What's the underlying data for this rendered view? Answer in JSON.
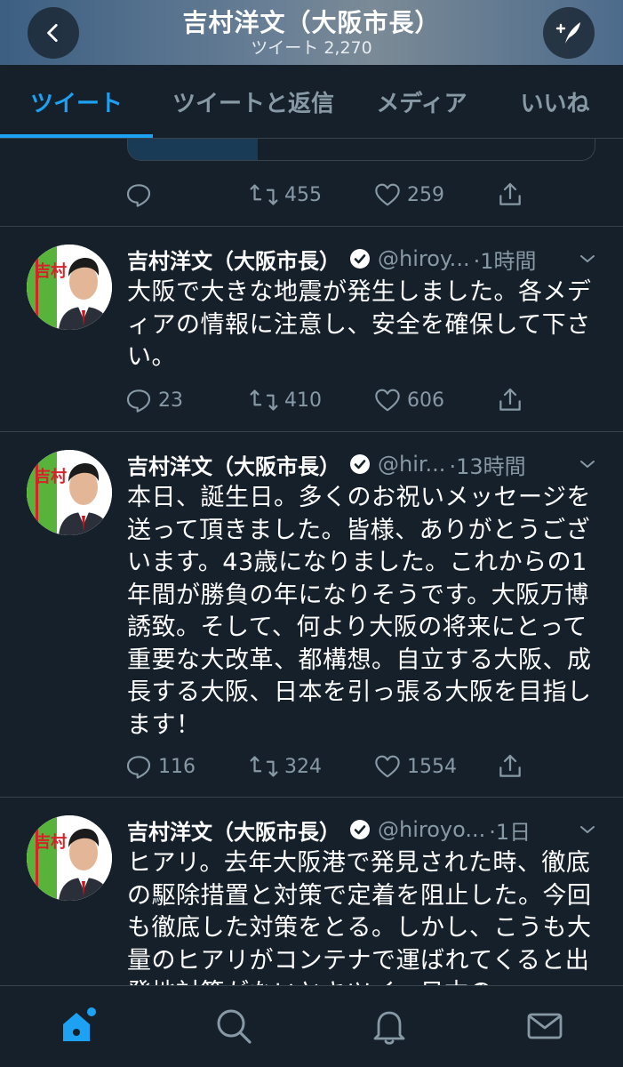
{
  "header": {
    "title": "吉村洋文（大阪市長）",
    "tweet_count": "ツイート 2,270",
    "back_icon": "chevron-left-icon",
    "compose_icon": "compose-tweet-icon"
  },
  "tabs": [
    {
      "label": "ツイート",
      "active": true
    },
    {
      "label": "ツイートと返信",
      "active": false
    },
    {
      "label": "メディア",
      "active": false
    },
    {
      "label": "いいね",
      "active": false
    }
  ],
  "partial_tweet": {
    "actions": {
      "replies": "",
      "retweets": "455",
      "likes": "259"
    }
  },
  "tweets": [
    {
      "name": "吉村洋文（大阪市長）",
      "handle": "@hiroy...",
      "time": "·1時間",
      "text": "大阪で大きな地震が発生しました。各メディアの情報に注意し、安全を確保して下さい。",
      "actions": {
        "replies": "23",
        "retweets": "410",
        "likes": "606"
      }
    },
    {
      "name": "吉村洋文（大阪市長）",
      "handle": "@hir...",
      "time": "·13時間",
      "text": "本日、誕生日。多くのお祝いメッセージを送って頂きました。皆様、ありがとうございます。43歳になりました。これからの1年間が勝負の年になりそうです。大阪万博誘致。そして、何より大阪の将来にとって重要な大改革、都構想。自立する大阪、成長する大阪、日本を引っ張る大阪を目指します！",
      "actions": {
        "replies": "116",
        "retweets": "324",
        "likes": "1554"
      }
    },
    {
      "name": "吉村洋文（大阪市長）",
      "handle": "@hiroyo...",
      "time": "·1日",
      "text": "ヒアリ。去年大阪港で発見された時、徹底の駆除措置と対策で定着を阻止した。今回も徹底した対策をとる。しかし、こうも大量のヒアリがコンテナで運ばれてくると出発地対策がないとキツイ。日本の",
      "actions": {
        "replies": "",
        "retweets": "",
        "likes": ""
      }
    }
  ],
  "avatar": {
    "sign_text": "吉村"
  },
  "bottom_nav": [
    {
      "icon": "home-icon",
      "active": true
    },
    {
      "icon": "search-icon",
      "active": false
    },
    {
      "icon": "notifications-bell-icon",
      "active": false
    },
    {
      "icon": "messages-envelope-icon",
      "active": false
    }
  ],
  "colors": {
    "background": "#15202b",
    "accent": "#1da1f2",
    "secondary_text": "#8899a6",
    "divider": "#38444d"
  }
}
